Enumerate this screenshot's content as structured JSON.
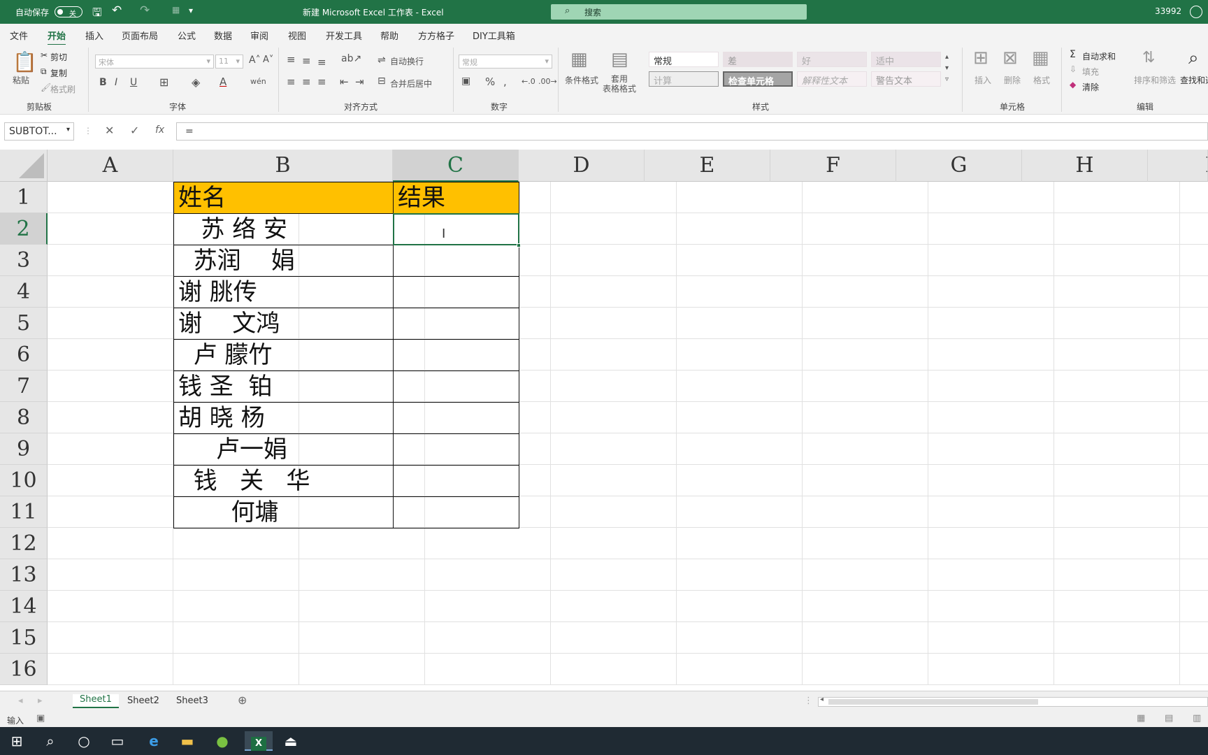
{
  "titlebar": {
    "autosave_label": "自动保存",
    "autosave_state": "关",
    "title": "新建 Microsoft Excel 工作表  -  Excel",
    "search_placeholder": "搜索",
    "user": "33992"
  },
  "menu": [
    "文件",
    "开始",
    "插入",
    "页面布局",
    "公式",
    "数据",
    "审阅",
    "视图",
    "开发工具",
    "帮助",
    "方方格子",
    "DIY工具箱"
  ],
  "ribbon": {
    "clipboard": {
      "paste": "粘贴",
      "cut": "剪切",
      "copy": "复制",
      "format_painter": "格式刷",
      "group": "剪贴板"
    },
    "font": {
      "name": "宋体",
      "size": "11",
      "group": "字体"
    },
    "alignment": {
      "wrap": "自动换行",
      "merge": "合并后居中",
      "group": "对齐方式"
    },
    "number": {
      "format": "常规",
      "group": "数字"
    },
    "styles": {
      "conditional": "条件格式",
      "table_format": "套用\n表格格式",
      "cells": [
        "常规",
        "差",
        "好",
        "适中",
        "计算",
        "检查单元格",
        "解释性文本",
        "警告文本"
      ],
      "group": "样式"
    },
    "cells": {
      "insert": "插入",
      "delete": "删除",
      "format": "格式",
      "group": "单元格"
    },
    "editing": {
      "autosum": "自动求和",
      "fill": "填充",
      "clear": "清除",
      "sort": "排序和筛选",
      "find": "查找和选",
      "group": "编辑"
    }
  },
  "formula_bar": {
    "name_box": "SUBTOT...",
    "formula": "="
  },
  "columns": [
    "A",
    "B",
    "C",
    "D",
    "E",
    "F",
    "G",
    "H",
    "I"
  ],
  "rows": [
    "1",
    "2",
    "3",
    "4",
    "5",
    "6",
    "7",
    "8",
    "9",
    "10",
    "11",
    "12",
    "13",
    "14",
    "15",
    "16"
  ],
  "table": {
    "header_b": "姓名",
    "header_c": "结果",
    "names": [
      "   苏 络 安",
      "  苏润    娟",
      "谢 朓传",
      "谢    文鸿",
      "  卢 朦竹",
      "钱 圣  铂",
      "胡 晓 杨",
      "     卢一娟",
      "  钱   关   华",
      "       何墉"
    ],
    "c2_value": "="
  },
  "sheets": [
    "Sheet1",
    "Sheet2",
    "Sheet3"
  ],
  "status": {
    "mode": "输入"
  },
  "colors": {
    "excel_green": "#217346",
    "header_fill": "#ffc000"
  }
}
